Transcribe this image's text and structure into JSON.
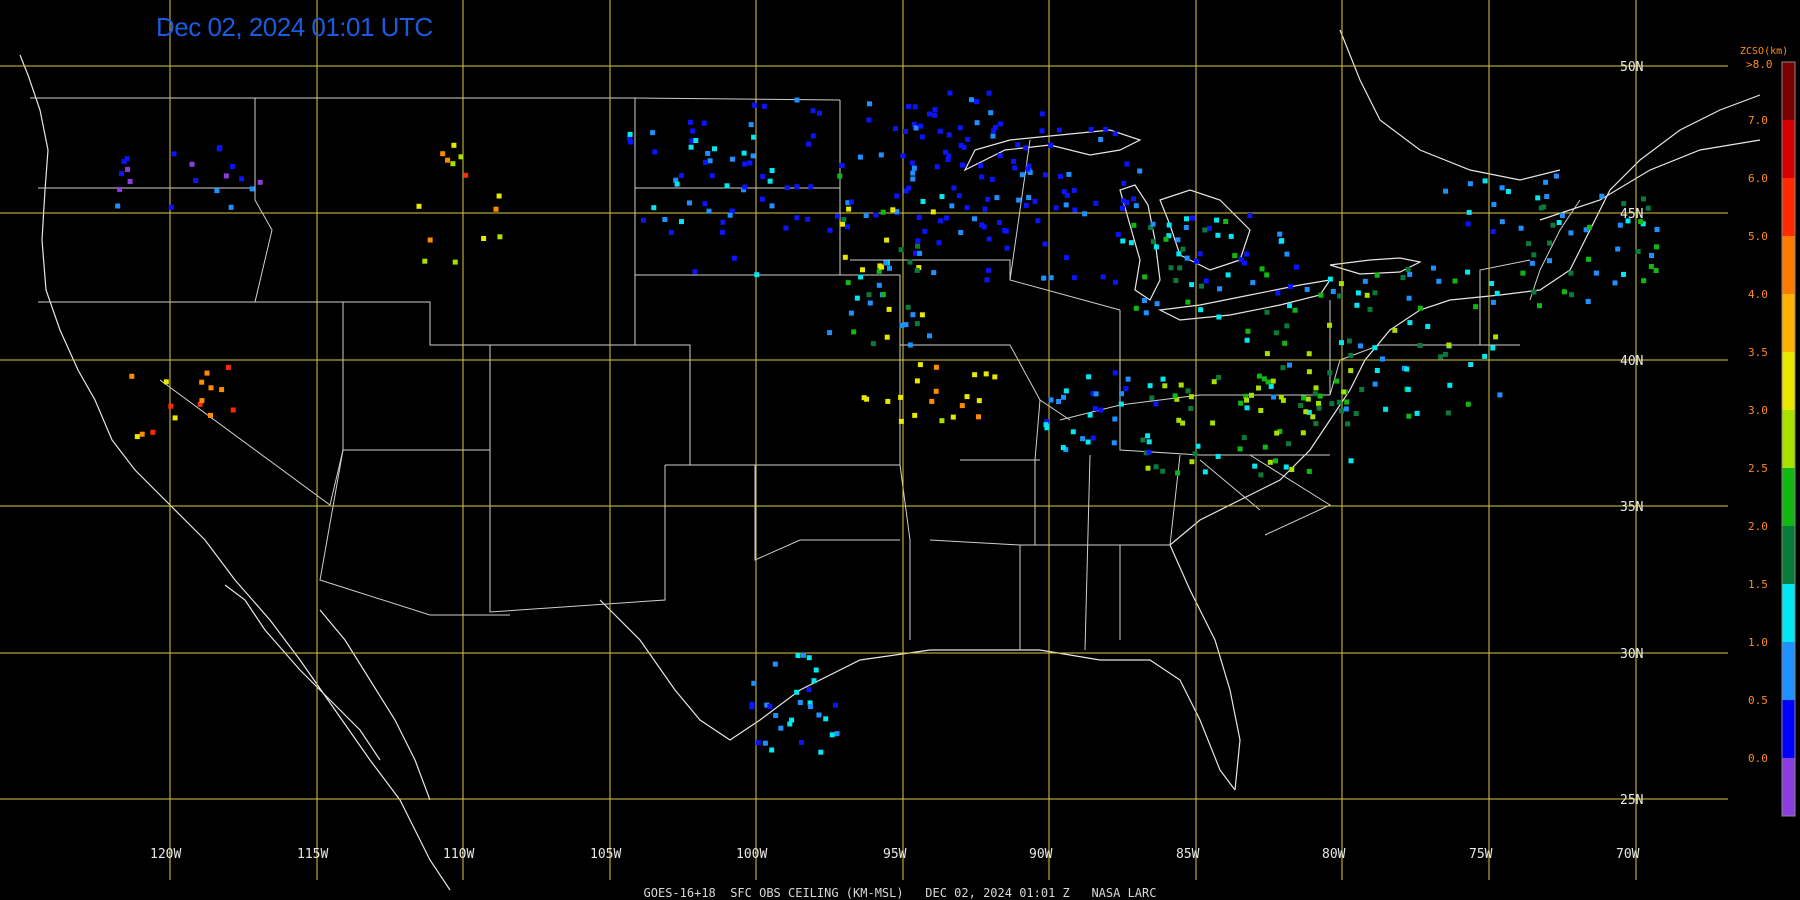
{
  "title": "Dec 02, 2024 01:01 UTC",
  "footer": "GOES-16+18  SFC OBS CEILING (KM-MSL)   DEC 02, 2024 01:01 Z   NASA LARC",
  "map": {
    "lat_lines": [
      "50N",
      "45N",
      "40N",
      "35N",
      "30N",
      "25N"
    ],
    "lon_lines": [
      "120W",
      "115W",
      "110W",
      "105W",
      "100W",
      "95W",
      "90W",
      "85W",
      "80W",
      "75W",
      "70W"
    ]
  },
  "colorbar": {
    "title": "ZCSO(km)",
    "top_label": ">8.0",
    "tick_labels": [
      "7.0",
      "6.0",
      "5.0",
      "4.0",
      "3.5",
      "3.0",
      "2.5",
      "2.0",
      "1.5",
      "1.0",
      "0.5",
      "0.0"
    ],
    "colors": [
      "#7a0000",
      "#d40000",
      "#ff2a00",
      "#ff7a00",
      "#ffb000",
      "#e8e800",
      "#a8e000",
      "#12b812",
      "#0a7a3a",
      "#00e8f0",
      "#1e90ff",
      "#0000ff",
      "#8a3ee0"
    ]
  }
}
